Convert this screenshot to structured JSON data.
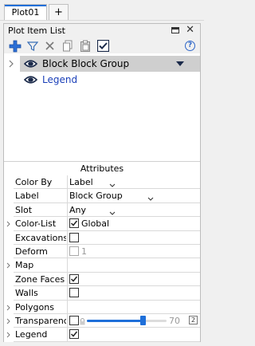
{
  "tabs": {
    "active_label": "Plot01",
    "add_label": "+"
  },
  "panel": {
    "title": "Plot Item List",
    "close_glyph": "✕"
  },
  "toolbar": {
    "icons": [
      "add-icon",
      "filter-icon",
      "delete-icon",
      "copy-icon",
      "paste-icon",
      "check-icon",
      "help-icon"
    ],
    "help_glyph": "?"
  },
  "tree": {
    "items": [
      {
        "label": "Block Block Group",
        "selected": true,
        "color": "#000000"
      },
      {
        "label": "Legend",
        "selected": false,
        "color": "#1a3fb8"
      }
    ]
  },
  "attributes": {
    "header": "Attributes",
    "rows": [
      {
        "name": "Color By",
        "type": "combo",
        "value": "Label"
      },
      {
        "name": "Label",
        "type": "combo",
        "value": "Block Group"
      },
      {
        "name": "Slot",
        "type": "combo",
        "value": "Any"
      },
      {
        "name": "Color-List",
        "type": "check",
        "checked": true,
        "text": "Global",
        "expandable": true
      },
      {
        "name": "Excavations",
        "type": "check",
        "checked": false,
        "text": ""
      },
      {
        "name": "Deform",
        "type": "check",
        "checked": false,
        "text": "1",
        "dim": true
      },
      {
        "name": "Map",
        "type": "none",
        "expandable": true
      },
      {
        "name": "Zone Faces",
        "type": "check",
        "checked": true,
        "text": ""
      },
      {
        "name": "Walls",
        "type": "check",
        "checked": false,
        "text": ""
      },
      {
        "name": "Polygons",
        "type": "none",
        "expandable": true
      },
      {
        "name": "Transparency",
        "type": "slider",
        "value": "70",
        "level": 0.7,
        "button": "2",
        "expandable": true
      },
      {
        "name": "Legend",
        "type": "check",
        "checked": true,
        "text": "",
        "expandable": true
      }
    ]
  },
  "colors": {
    "accent": "#1e6fd9",
    "selection": "#cfcfcf",
    "eye_dark": "#1b2a4a"
  }
}
